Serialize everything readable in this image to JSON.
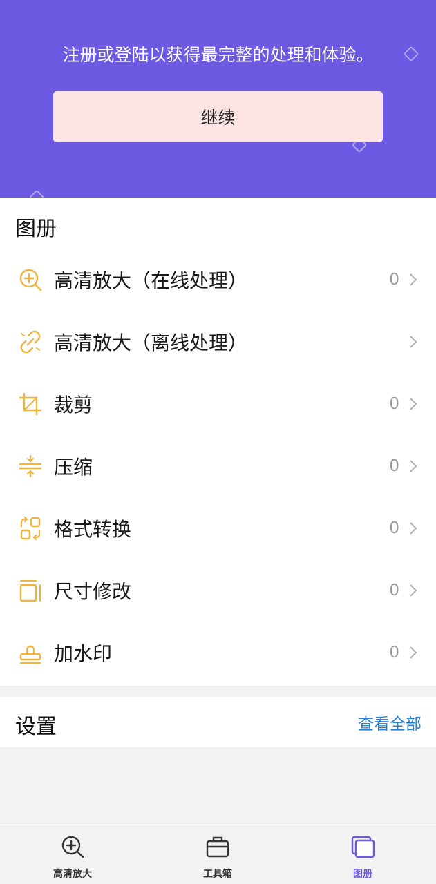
{
  "banner": {
    "text": "注册或登陆以获得最完整的处理和体验。",
    "button_label": "继续",
    "background": "#6d5ae3"
  },
  "album": {
    "title": "图册",
    "items": [
      {
        "icon": "zoom-in-icon",
        "label": "高清放大（在线处理）",
        "count": "0"
      },
      {
        "icon": "broken-link-icon",
        "label": "高清放大（离线处理）",
        "count": ""
      },
      {
        "icon": "crop-icon",
        "label": "裁剪",
        "count": "0"
      },
      {
        "icon": "compress-icon",
        "label": "压缩",
        "count": "0"
      },
      {
        "icon": "format-convert-icon",
        "label": "格式转换",
        "count": "0"
      },
      {
        "icon": "resize-icon",
        "label": "尺寸修改",
        "count": "0"
      },
      {
        "icon": "stamp-icon",
        "label": "加水印",
        "count": "0"
      }
    ],
    "icon_color": "#f0b43c"
  },
  "settings": {
    "title": "设置",
    "view_all": "查看全部"
  },
  "tabbar": {
    "tabs": [
      {
        "label": "高清放大",
        "icon": "zoom-in-icon",
        "active": false
      },
      {
        "label": "工具箱",
        "icon": "toolbox-icon",
        "active": false
      },
      {
        "label": "图册",
        "icon": "album-icon",
        "active": true
      }
    ],
    "active_color": "#6d5ae3"
  }
}
